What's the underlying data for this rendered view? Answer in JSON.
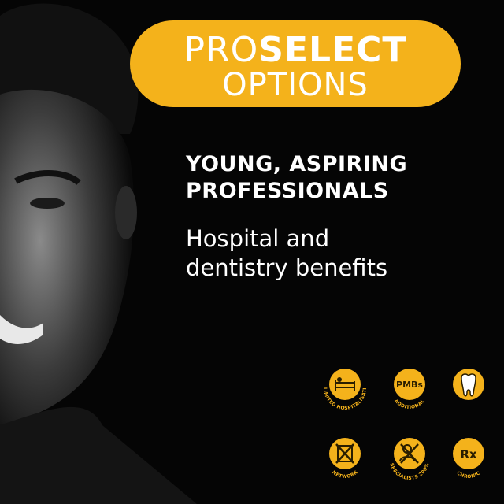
{
  "header": {
    "pro": "PRO",
    "select": "SELECT",
    "options": "OPTIONS"
  },
  "headline": {
    "line1": "YOUNG, ASPIRING",
    "line2": "PROFESSIONALS"
  },
  "subline": {
    "line1": "Hospital and",
    "line2": "dentistry benefits"
  },
  "icons": [
    {
      "name": "hospital-bed-icon",
      "label": "UNLIMITED HOSPITALISATION"
    },
    {
      "name": "pmbs-icon",
      "text": "PMBs",
      "label": "ADDITIONAL"
    },
    {
      "name": "tooth-icon",
      "label": ""
    },
    {
      "name": "network-crossed-icon",
      "label": "NETWORK"
    },
    {
      "name": "specialists-crossed-icon",
      "label": "SPECIALISTS 200%"
    },
    {
      "name": "rx-icon",
      "text": "Rx",
      "label": "CHRONIC"
    }
  ],
  "colors": {
    "accent": "#F4B21B",
    "background": "#050505",
    "text": "#ffffff"
  }
}
